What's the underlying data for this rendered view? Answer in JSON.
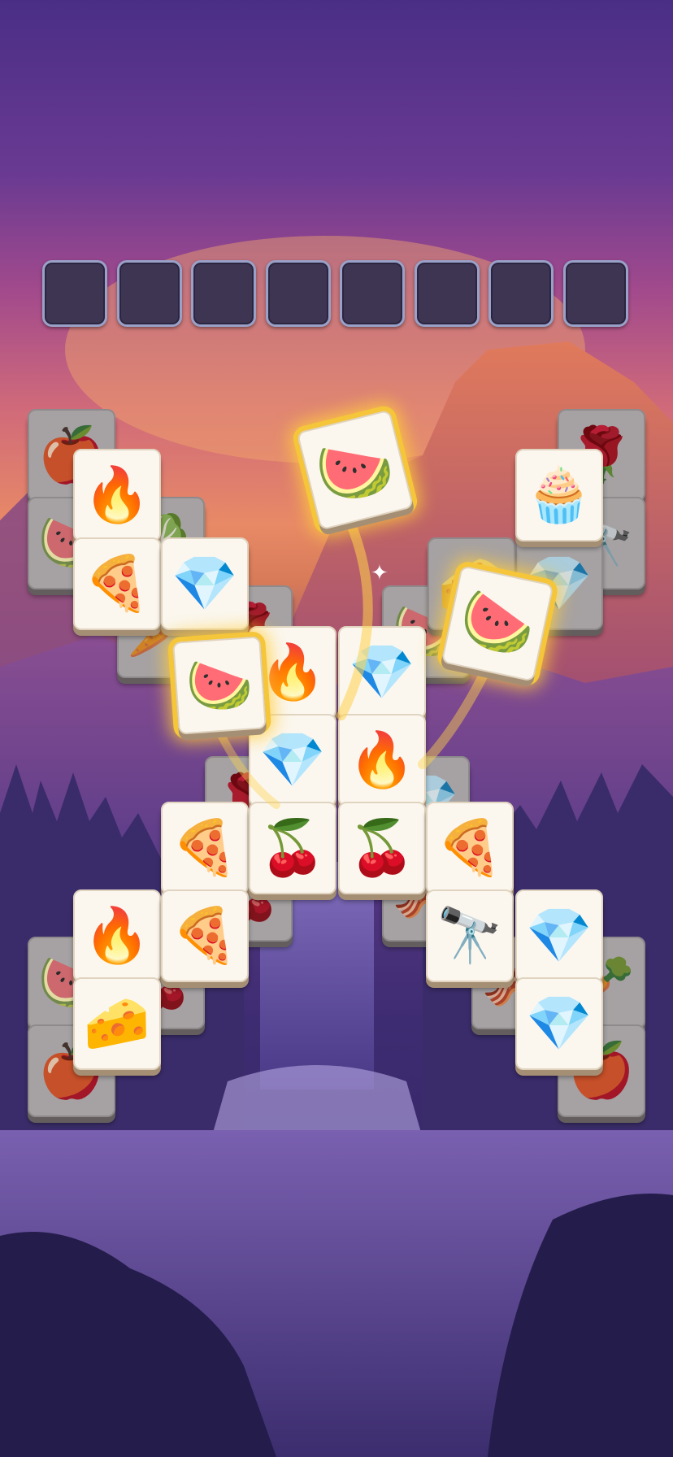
{
  "game": {
    "tray": {
      "slots": 8
    },
    "tiles": [
      {
        "icon": "apple-icon",
        "glyph": "🍎",
        "layer": "under"
      },
      {
        "icon": "watermelon-icon",
        "glyph": "🍉",
        "layer": "under"
      },
      {
        "icon": "fire-icon",
        "glyph": "🔥",
        "layer": "top"
      },
      {
        "icon": "leaf-icon",
        "glyph": "🥬",
        "layer": "under"
      },
      {
        "icon": "pizza-icon",
        "glyph": "🍕",
        "layer": "top"
      },
      {
        "icon": "diamond-icon",
        "glyph": "💎",
        "layer": "top"
      },
      {
        "icon": "carrot-icon",
        "glyph": "🥕",
        "layer": "under"
      },
      {
        "icon": "rose-icon",
        "glyph": "🌹",
        "layer": "under"
      },
      {
        "icon": "rose-icon",
        "glyph": "🌹",
        "layer": "under"
      },
      {
        "icon": "cupcake-icon",
        "glyph": "🧁",
        "layer": "top"
      },
      {
        "icon": "binoculars-icon",
        "glyph": "🔭",
        "layer": "under"
      },
      {
        "icon": "diamond-icon",
        "glyph": "💎",
        "layer": "under"
      },
      {
        "icon": "cheese-icon",
        "glyph": "🧀",
        "layer": "under"
      },
      {
        "icon": "watermelon-icon",
        "glyph": "🍉",
        "layer": "under"
      },
      {
        "icon": "fire-icon",
        "glyph": "🔥",
        "layer": "top"
      },
      {
        "icon": "diamond-icon",
        "glyph": "💎",
        "layer": "top"
      },
      {
        "icon": "diamond-icon",
        "glyph": "💎",
        "layer": "top"
      },
      {
        "icon": "fire-icon",
        "glyph": "🔥",
        "layer": "top"
      },
      {
        "icon": "rose-icon",
        "glyph": "🌹",
        "layer": "under"
      },
      {
        "icon": "diamond-icon",
        "glyph": "💎",
        "layer": "under"
      },
      {
        "icon": "pizza-icon",
        "glyph": "🍕",
        "layer": "top"
      },
      {
        "icon": "cherry-icon",
        "glyph": "🍒",
        "layer": "top"
      },
      {
        "icon": "cherry-icon",
        "glyph": "🍒",
        "layer": "top"
      },
      {
        "icon": "pizza-icon",
        "glyph": "🍕",
        "layer": "top"
      },
      {
        "icon": "cherry-icon",
        "glyph": "🍒",
        "layer": "under"
      },
      {
        "icon": "bacon-icon",
        "glyph": "🥓",
        "layer": "under"
      },
      {
        "icon": "fire-icon",
        "glyph": "🔥",
        "layer": "top"
      },
      {
        "icon": "pizza-icon",
        "glyph": "🍕",
        "layer": "top"
      },
      {
        "icon": "binoculars-icon",
        "glyph": "🔭",
        "layer": "top"
      },
      {
        "icon": "diamond-icon",
        "glyph": "💎",
        "layer": "top"
      },
      {
        "icon": "watermelon-icon",
        "glyph": "🍉",
        "layer": "under"
      },
      {
        "icon": "cherry-icon",
        "glyph": "🍒",
        "layer": "under"
      },
      {
        "icon": "cheese-icon",
        "glyph": "🧀",
        "layer": "top"
      },
      {
        "icon": "bacon-icon",
        "glyph": "🥓",
        "layer": "under"
      },
      {
        "icon": "carrot-icon",
        "glyph": "🥕",
        "layer": "under"
      },
      {
        "icon": "diamond-icon",
        "glyph": "💎",
        "layer": "top"
      },
      {
        "icon": "apple-icon",
        "glyph": "🍎",
        "layer": "under"
      },
      {
        "icon": "apple-icon",
        "glyph": "🍎",
        "layer": "under"
      }
    ],
    "flying_tiles": [
      {
        "icon": "watermelon-icon",
        "glyph": "🍉"
      },
      {
        "icon": "watermelon-icon",
        "glyph": "🍉"
      },
      {
        "icon": "watermelon-icon",
        "glyph": "🍉"
      }
    ],
    "sparkle": "✦"
  }
}
